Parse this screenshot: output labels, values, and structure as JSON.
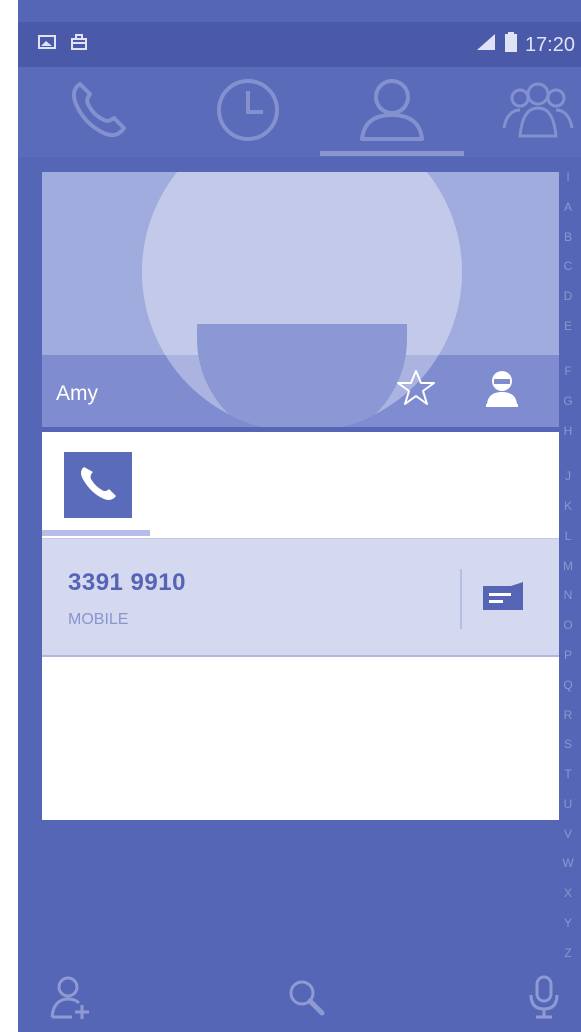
{
  "status_bar": {
    "time": "17:20",
    "left_icons": [
      "image-notification-icon",
      "shop-notification-icon"
    ],
    "right_icons": [
      "signal-icon",
      "battery-icon"
    ]
  },
  "tabs": [
    {
      "name": "phone",
      "icon": "phone-icon",
      "selected": false
    },
    {
      "name": "call-log",
      "icon": "clock-icon",
      "selected": false
    },
    {
      "name": "contacts",
      "icon": "person-icon",
      "selected": true
    },
    {
      "name": "groups",
      "icon": "group-icon",
      "selected": false
    }
  ],
  "contact": {
    "name": "Amy",
    "favorite_icon": "star-outline-icon",
    "account_icon": "contact-card-icon"
  },
  "details": {
    "selected_tab_icon": "phone-icon",
    "phone_number": "3391 9910",
    "phone_type": "MOBILE",
    "action_icon": "message-icon"
  },
  "alpha_index": [
    "I",
    "A",
    "B",
    "C",
    "D",
    "E",
    "",
    "F",
    "G",
    "H",
    "",
    "J",
    "K",
    "L",
    "M",
    "N",
    "O",
    "P",
    "Q",
    "R",
    "S",
    "T",
    "U",
    "V",
    "W",
    "X",
    "Y",
    "Z"
  ],
  "bottom_bar": [
    {
      "name": "add-contact",
      "icon": "add-person-icon"
    },
    {
      "name": "search",
      "icon": "search-icon"
    },
    {
      "name": "voice",
      "icon": "microphone-icon"
    }
  ],
  "colors": {
    "primary": "#5566b6",
    "status_bar": "#4a5aa8",
    "highlight_row": "#d4d9f0",
    "text_accent": "#5664b6"
  }
}
